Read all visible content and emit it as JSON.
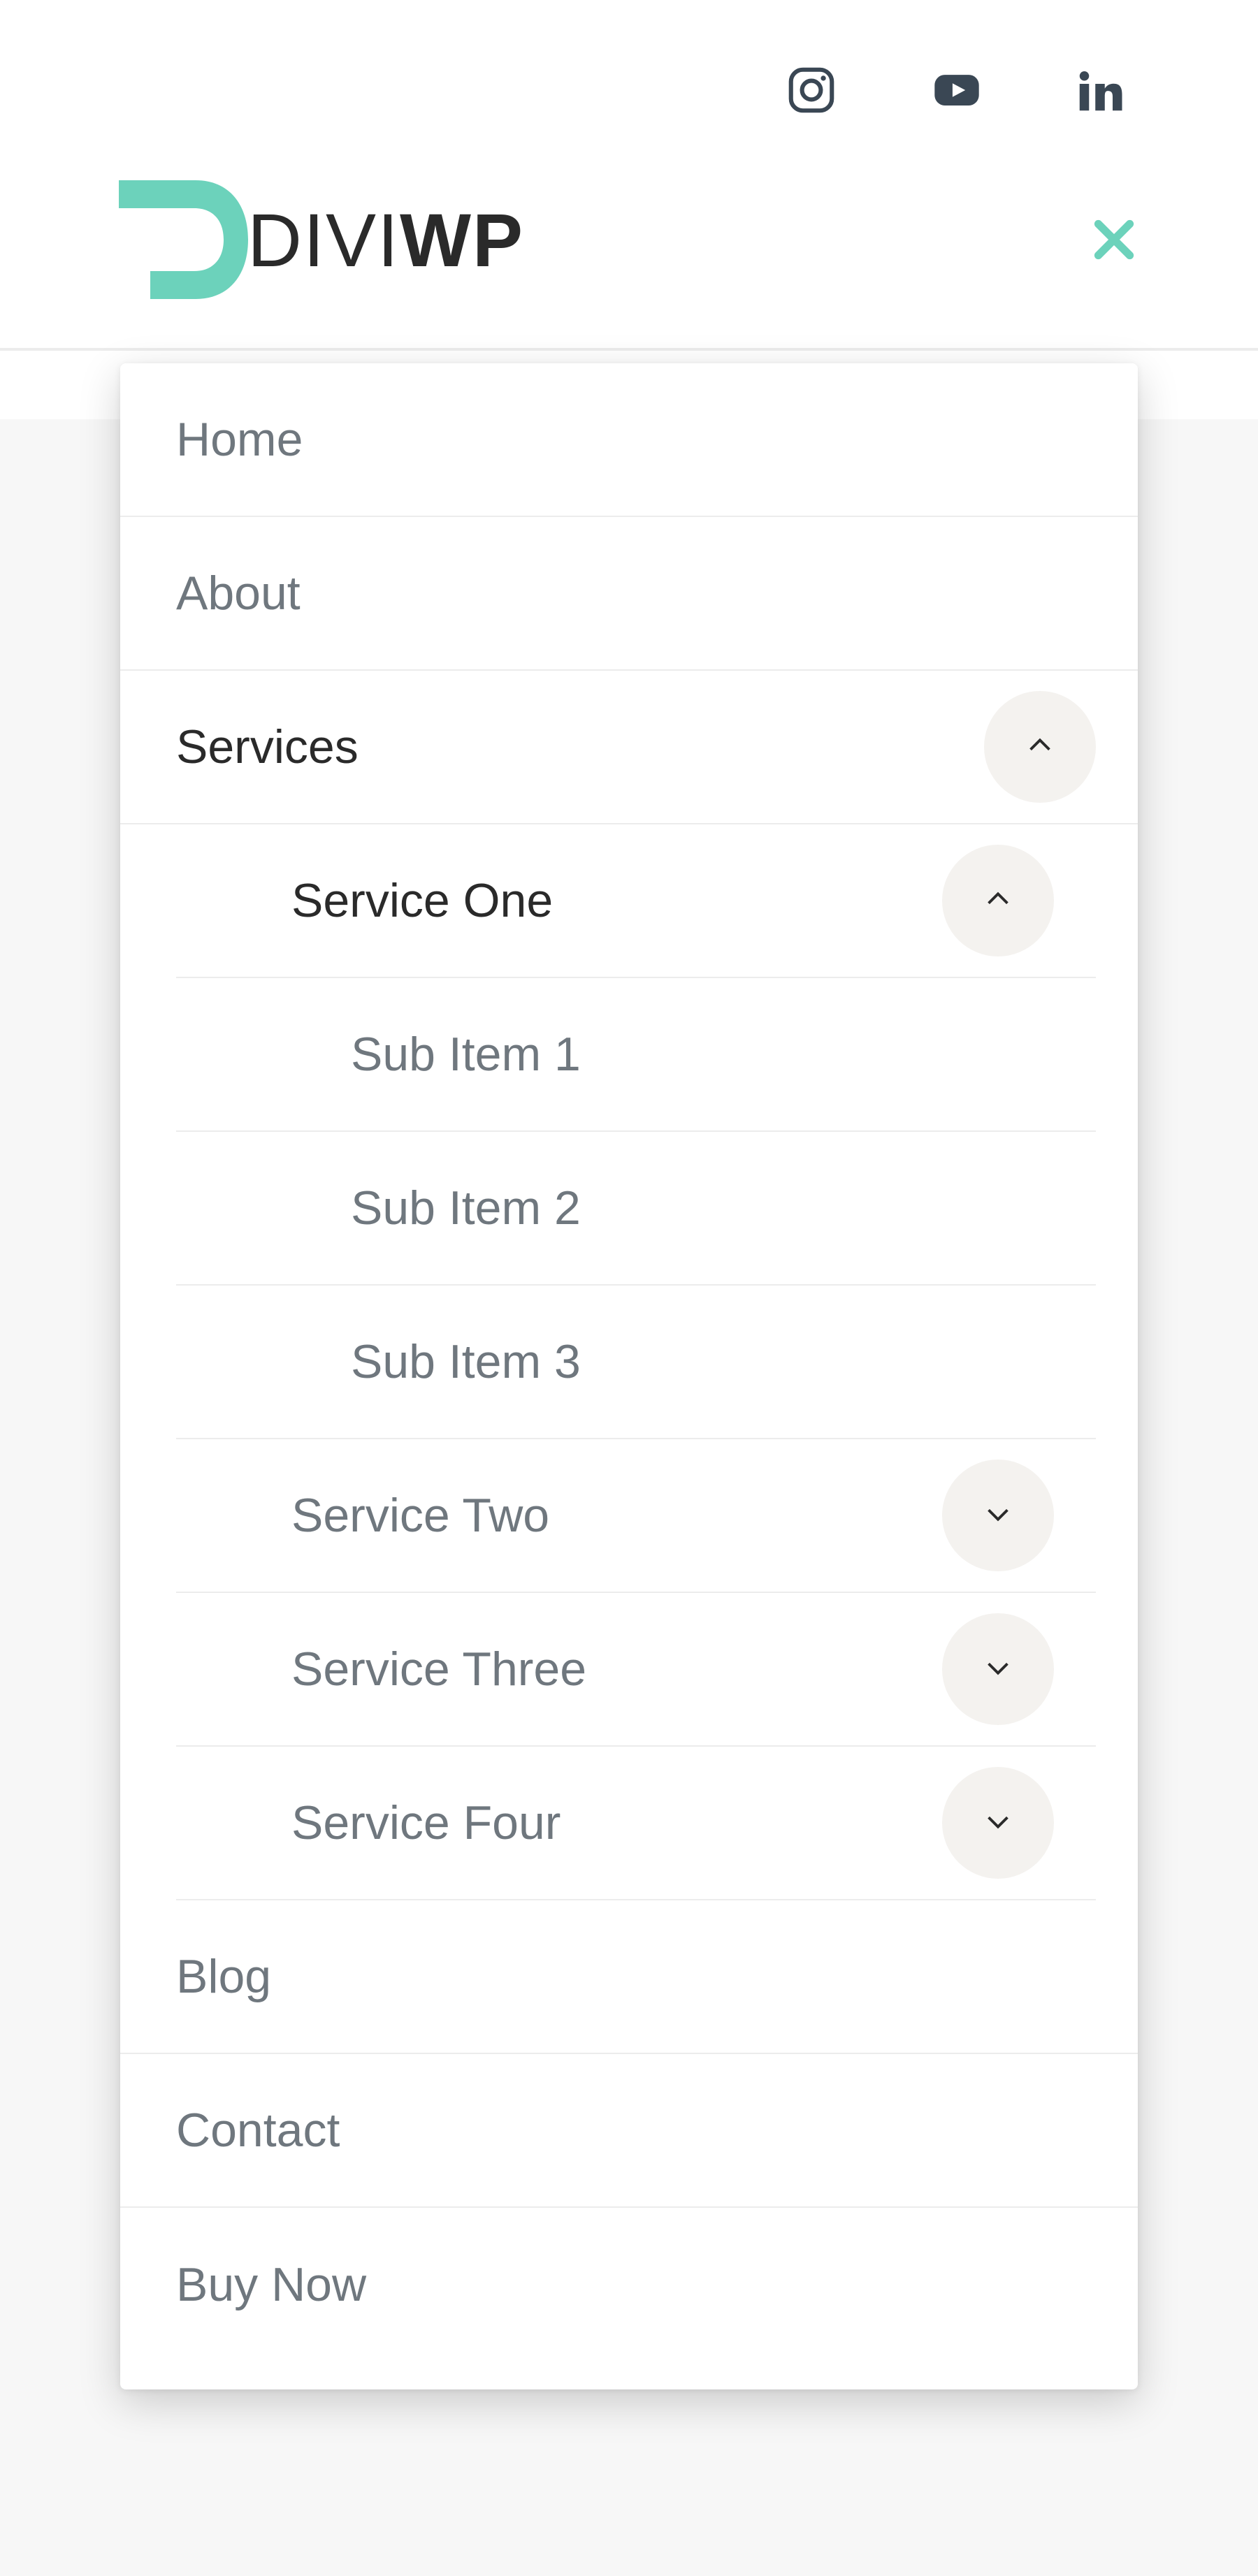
{
  "brand": {
    "name_light": "DIVI",
    "name_bold": "WP"
  },
  "social": {
    "instagram_title": "Instagram",
    "youtube_title": "YouTube",
    "linkedin_title": "LinkedIn"
  },
  "header": {
    "close_label": "Close menu"
  },
  "menu": {
    "home": "Home",
    "about": "About",
    "services": {
      "label": "Services",
      "one": {
        "label": "Service One",
        "sub1": "Sub Item 1",
        "sub2": "Sub Item 2",
        "sub3": "Sub Item 3"
      },
      "two": "Service Two",
      "three": "Service Three",
      "four": "Service Four"
    },
    "blog": "Blog",
    "contact": "Contact",
    "buy_now": "Buy Now"
  }
}
